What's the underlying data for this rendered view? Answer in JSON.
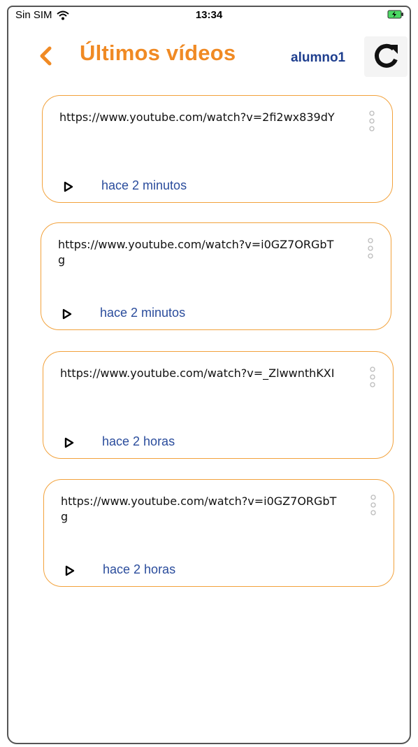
{
  "status_bar": {
    "carrier": "Sin SIM",
    "time": "13:34"
  },
  "header": {
    "title": "Últimos vídeos",
    "user": "alumno1"
  },
  "icons": {
    "back": "chevron-left-icon",
    "refresh": "refresh-icon",
    "more": "more-vertical-icon",
    "play": "play-icon",
    "wifi": "wifi-icon",
    "battery": "battery-charging-icon"
  },
  "colors": {
    "accent": "#f08a24",
    "card_border": "#f2a23c",
    "user": "#1f3f8f",
    "time_text": "#2a4c9c"
  },
  "videos": [
    {
      "url": "https://www.youtube.com/watch?v=2fi2wx839dY",
      "time": "hace 2 minutos"
    },
    {
      "url": "https://www.youtube.com/watch?v=i0GZ7ORGbTg",
      "time": "hace 2 minutos"
    },
    {
      "url": "https://www.youtube.com/watch?v=_ZlwwnthKXI",
      "time": "hace 2 horas"
    },
    {
      "url": "https://www.youtube.com/watch?v=i0GZ7ORGbTg",
      "time": "hace 2 horas"
    }
  ]
}
